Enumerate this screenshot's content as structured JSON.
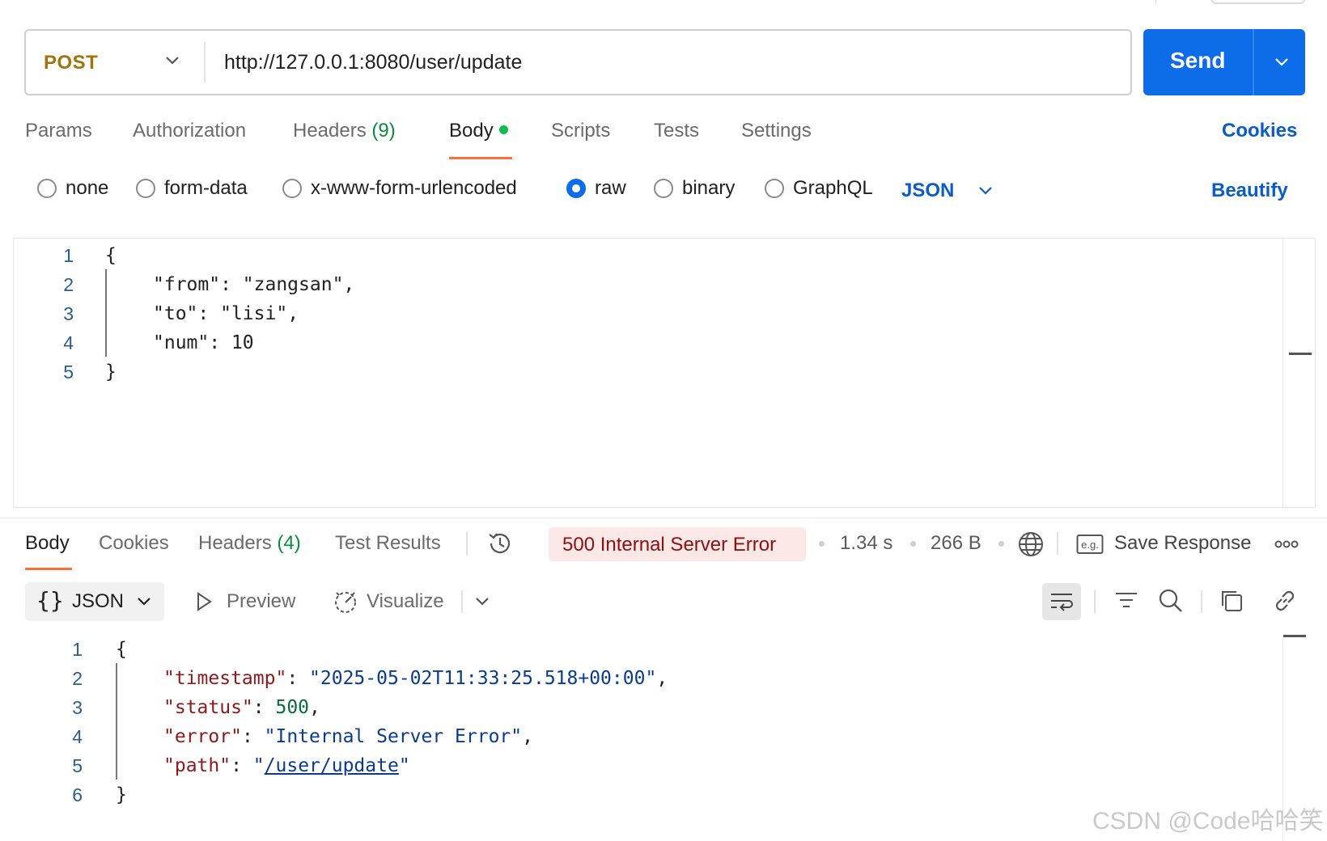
{
  "request": {
    "method": "POST",
    "url": "http://127.0.0.1:8080/user/update",
    "send_label": "Send"
  },
  "request_tabs": {
    "params": "Params",
    "authorization": "Authorization",
    "headers": "Headers",
    "headers_count": "(9)",
    "body": "Body",
    "scripts": "Scripts",
    "tests": "Tests",
    "settings": "Settings",
    "cookies": "Cookies",
    "active": "Body"
  },
  "body_types": {
    "none": "none",
    "form_data": "form-data",
    "urlencoded": "x-www-form-urlencoded",
    "raw": "raw",
    "binary": "binary",
    "graphql": "GraphQL",
    "selected": "raw",
    "format": "JSON",
    "beautify": "Beautify"
  },
  "request_body": {
    "line_numbers": [
      "1",
      "2",
      "3",
      "4",
      "5"
    ],
    "open_brace": "{",
    "close_brace": "}",
    "k1": "\"from\"",
    "v1": "\"zangsan\"",
    "k2": "\"to\"",
    "v2": "\"lisi\"",
    "k3": "\"num\"",
    "v3": "10"
  },
  "response_tabs": {
    "body": "Body",
    "cookies": "Cookies",
    "headers": "Headers",
    "headers_count": "(4)",
    "test_results": "Test Results",
    "active": "Body"
  },
  "response_meta": {
    "status": "500 Internal Server Error",
    "time": "1.34 s",
    "size": "266 B",
    "save_response": "Save Response"
  },
  "response_view": {
    "format": "JSON",
    "preview": "Preview",
    "visualize": "Visualize"
  },
  "response_body": {
    "line_numbers": [
      "1",
      "2",
      "3",
      "4",
      "5",
      "6"
    ],
    "open_brace": "{",
    "close_brace": "}",
    "k1": "\"timestamp\"",
    "v1": "\"2025-05-02T11:33:25.518+00:00\"",
    "k2": "\"status\"",
    "v2": "500",
    "k3": "\"error\"",
    "v3": "\"Internal Server Error\"",
    "k4": "\"path\"",
    "v4": "/user/update"
  },
  "colors": {
    "accent": "#0d6ce8",
    "method": "#a0740f",
    "tab_indicator": "#ff6c37",
    "error_bg": "#fde8e8",
    "error_text": "#8f0e0e"
  },
  "watermark": "CSDN @Code哈哈笑"
}
